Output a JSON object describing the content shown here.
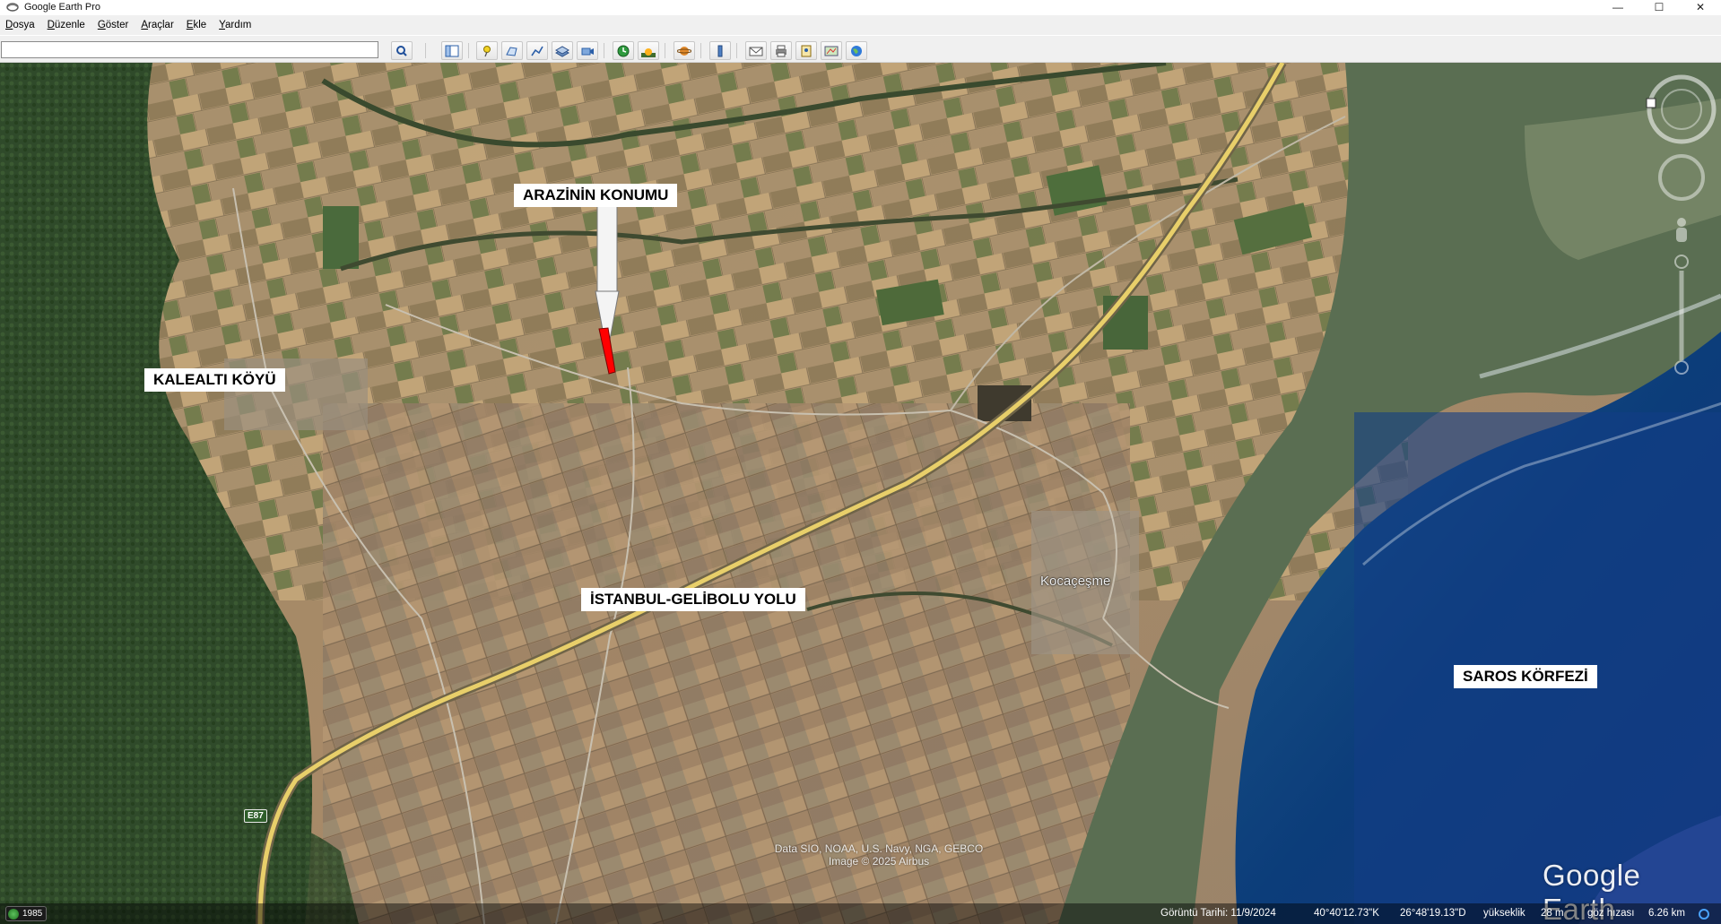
{
  "window": {
    "title": "Google Earth Pro",
    "minimize": "—",
    "maximize": "☐",
    "close": "✕"
  },
  "menu": {
    "items": [
      {
        "underline": "D",
        "rest": "osya"
      },
      {
        "underline": "D",
        "rest": "üzenle"
      },
      {
        "underline": "G",
        "rest": "öster"
      },
      {
        "underline": "A",
        "rest": "raçlar"
      },
      {
        "underline": "E",
        "rest": "kle"
      },
      {
        "underline": "Y",
        "rest": "ardım"
      }
    ]
  },
  "toolbar": {
    "search_value": "",
    "buttons": [
      {
        "name": "search-button",
        "icon": "magnifier-icon"
      },
      {
        "name": "sidebar-toggle-button",
        "icon": "sidebar-icon"
      },
      {
        "name": "add-placemark-button",
        "icon": "pushpin-icon"
      },
      {
        "name": "add-polygon-button",
        "icon": "polygon-icon"
      },
      {
        "name": "add-path-button",
        "icon": "path-icon"
      },
      {
        "name": "add-image-overlay-button",
        "icon": "image-overlay-icon"
      },
      {
        "name": "record-tour-button",
        "icon": "record-tour-icon"
      },
      {
        "name": "historical-imagery-button",
        "icon": "clock-icon"
      },
      {
        "name": "sunlight-button",
        "icon": "sun-icon"
      },
      {
        "name": "switch-planet-button",
        "icon": "planet-icon"
      },
      {
        "name": "ruler-button",
        "icon": "ruler-icon"
      },
      {
        "name": "email-button",
        "icon": "envelope-icon"
      },
      {
        "name": "print-button",
        "icon": "printer-icon"
      },
      {
        "name": "save-image-button",
        "icon": "save-image-icon"
      },
      {
        "name": "view-in-maps-button",
        "icon": "maps-icon"
      },
      {
        "name": "google-earth-web-button",
        "icon": "globe-icon"
      }
    ]
  },
  "map": {
    "labels": {
      "location": "ARAZİNİN KONUMU",
      "village": "KALEALTI KÖYÜ",
      "road": "İSTANBUL-GELİBOLU YOLU",
      "gulf": "SAROS KÖRFEZİ"
    },
    "town": "Kocaçeşme",
    "road_shield": "E87",
    "attribution_line1": "Data SIO, NOAA, U.S. Navy, NGA, GEBCO",
    "attribution_line2": "Image © 2025 Airbus",
    "watermark": "Google Earth"
  },
  "status": {
    "year": "1985",
    "imagery_date": "Görüntü Tarihi: 11/9/2024",
    "latitude": "40°40'12.73\"K",
    "longitude": "26°48'19.13\"D",
    "elevation_label": "yükseklik",
    "elevation_value": "28 m",
    "eye_alt_label": "göz hızası",
    "eye_alt_value": "6.26 km"
  },
  "colors": {
    "sea_deep": "#0c3d7a",
    "field_tan": "#b89870",
    "forest": "#2f4a2a",
    "highway": "#e8cf6a",
    "parcel": "#ff0000"
  }
}
